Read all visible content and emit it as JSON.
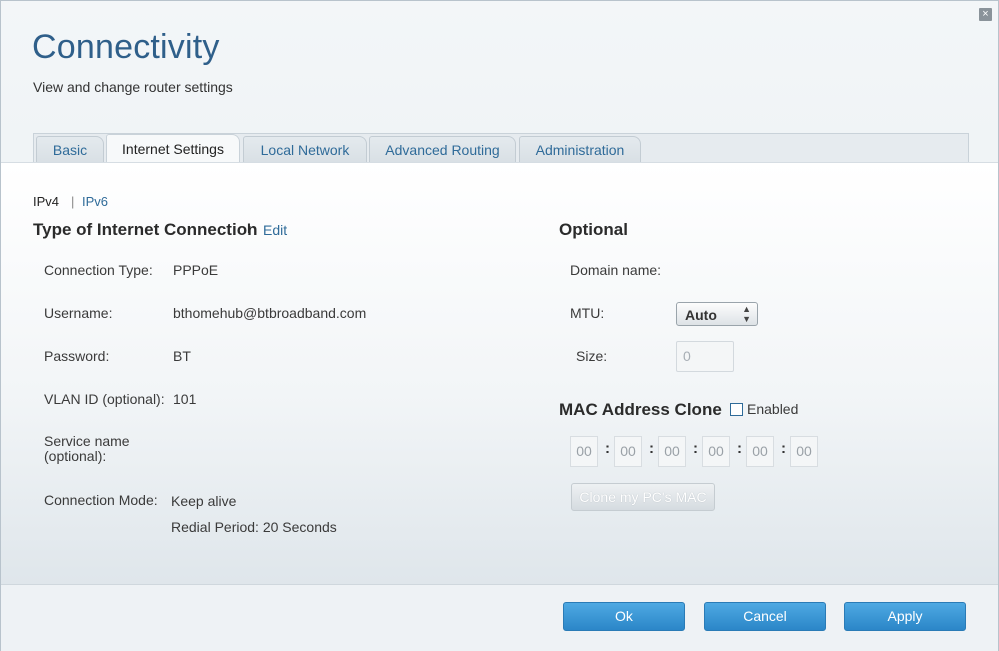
{
  "header": {
    "title": "Connectivity",
    "subtitle": "View and change router settings",
    "close_glyph": "×"
  },
  "tabs": [
    {
      "label": "Basic"
    },
    {
      "label": "Internet Settings",
      "active": true
    },
    {
      "label": "Local Network"
    },
    {
      "label": "Advanced Routing"
    },
    {
      "label": "Administration"
    }
  ],
  "ip_toggle": {
    "ipv4": "IPv4",
    "separator": "|",
    "ipv6": "IPv6"
  },
  "connection": {
    "heading": "Type of Internet Connection",
    "heading_sep": "I",
    "edit_label": "Edit",
    "rows": [
      {
        "label": "Connection Type:",
        "value": "PPPoE"
      },
      {
        "label": "Username:",
        "value": "bthomehub@btbroadband.com"
      },
      {
        "label": "Password:",
        "value": "BT"
      },
      {
        "label": "VLAN ID (optional):",
        "value": "101"
      },
      {
        "label": "Service name\n(optional):",
        "value": ""
      },
      {
        "label": "Connection Mode:",
        "value": "Keep alive"
      }
    ],
    "redial": "Redial Period: 20 Seconds"
  },
  "optional": {
    "heading": "Optional",
    "domain_label": "Domain name:",
    "mtu_label": "MTU:",
    "mtu_value": "Auto",
    "size_label": "Size:",
    "size_placeholder": "0"
  },
  "mac_clone": {
    "heading": "MAC Address Clone",
    "enabled_label": "Enabled",
    "octets": [
      "00",
      "00",
      "00",
      "00",
      "00",
      "00"
    ],
    "separator": ":",
    "clone_button": "Clone my PC's MAC"
  },
  "footer": {
    "ok": "Ok",
    "cancel": "Cancel",
    "apply": "Apply"
  },
  "colors": {
    "accent": "#2f6b99",
    "button": "#3b98d8",
    "title": "#2f5f8a"
  }
}
